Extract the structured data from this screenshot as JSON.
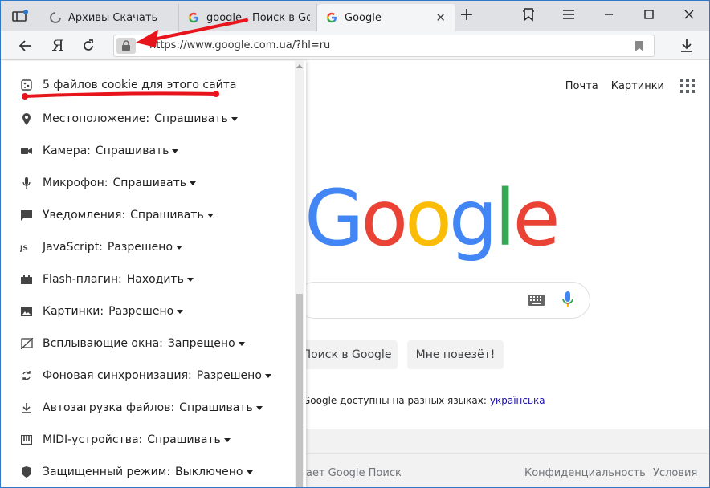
{
  "tabs": [
    {
      "title": "Архивы Скачать",
      "active": false
    },
    {
      "title": "google - Поиск в Goog",
      "active": false
    },
    {
      "title": "Google",
      "active": true
    }
  ],
  "address_bar": {
    "url": "https://www.google.com.ua/?hl=ru"
  },
  "toolbar": {
    "yandex_label": "Я"
  },
  "google": {
    "header": {
      "mail": "Почта",
      "images": "Картинки"
    },
    "logo": [
      "G",
      "o",
      "o",
      "g",
      "l",
      "e"
    ],
    "logo_colors": [
      "#4285f4",
      "#ea4335",
      "#fbbc05",
      "#4285f4",
      "#34a853",
      "#ea4335"
    ],
    "search_button": "Поиск в Google",
    "lucky_button": "Мне повезёт!",
    "languages_text": "Google доступны на разных языках:",
    "language_link": "українська",
    "footer": {
      "about": "ает Google Поиск",
      "privacy": "Конфиденциальность",
      "terms": "Условия"
    }
  },
  "popup": {
    "cookies": "5 файлов cookie для этого сайта",
    "permissions": [
      {
        "name": "location",
        "icon": "location-pin-icon",
        "label": "Местоположение:",
        "value": "Спрашивать"
      },
      {
        "name": "camera",
        "icon": "camera-icon",
        "label": "Камера:",
        "value": "Спрашивать"
      },
      {
        "name": "microphone",
        "icon": "microphone-icon",
        "label": "Микрофон:",
        "value": "Спрашивать"
      },
      {
        "name": "notifications",
        "icon": "notification-icon",
        "label": "Уведомления:",
        "value": "Спрашивать"
      },
      {
        "name": "javascript",
        "icon": "js-icon",
        "label": "JavaScript:",
        "value": "Разрешено"
      },
      {
        "name": "flash",
        "icon": "puzzle-icon",
        "label": "Flash-плагин:",
        "value": "Находить"
      },
      {
        "name": "images",
        "icon": "image-icon",
        "label": "Картинки:",
        "value": "Разрешено"
      },
      {
        "name": "popups",
        "icon": "popup-blocked-icon",
        "label": "Всплывающие окна:",
        "value": "Запрещено"
      },
      {
        "name": "background-sync",
        "icon": "sync-icon",
        "label": "Фоновая синхронизация:",
        "value": "Разрешено"
      },
      {
        "name": "auto-downloads",
        "icon": "download-icon",
        "label": "Автозагрузка файлов:",
        "value": "Спрашивать"
      },
      {
        "name": "midi",
        "icon": "midi-icon",
        "label": "MIDI-устройства:",
        "value": "Спрашивать"
      },
      {
        "name": "protected-mode",
        "icon": "shield-icon",
        "label": "Защищенный режим:",
        "value": "Выключено"
      }
    ]
  },
  "colors": {
    "annotation": "#e8141c",
    "link": "#1a0dab",
    "window_border": "#2f77c9"
  }
}
